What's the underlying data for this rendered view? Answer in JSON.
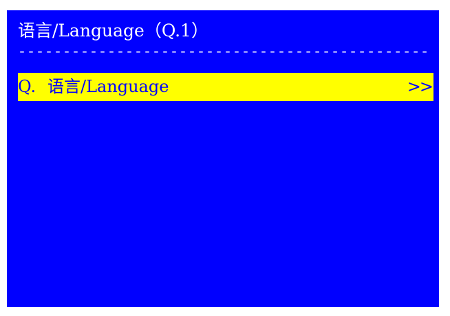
{
  "title": "语言/Language（Q.1）",
  "separator": "----------------------------------------------",
  "menu": {
    "items": [
      {
        "key": "Q.",
        "label": "语言/Language",
        "arrow": ">>"
      }
    ]
  },
  "colors": {
    "background": "#0000ff",
    "text": "#ffffff",
    "highlight": "#ffff00",
    "highlight_text": "#0000ff"
  }
}
